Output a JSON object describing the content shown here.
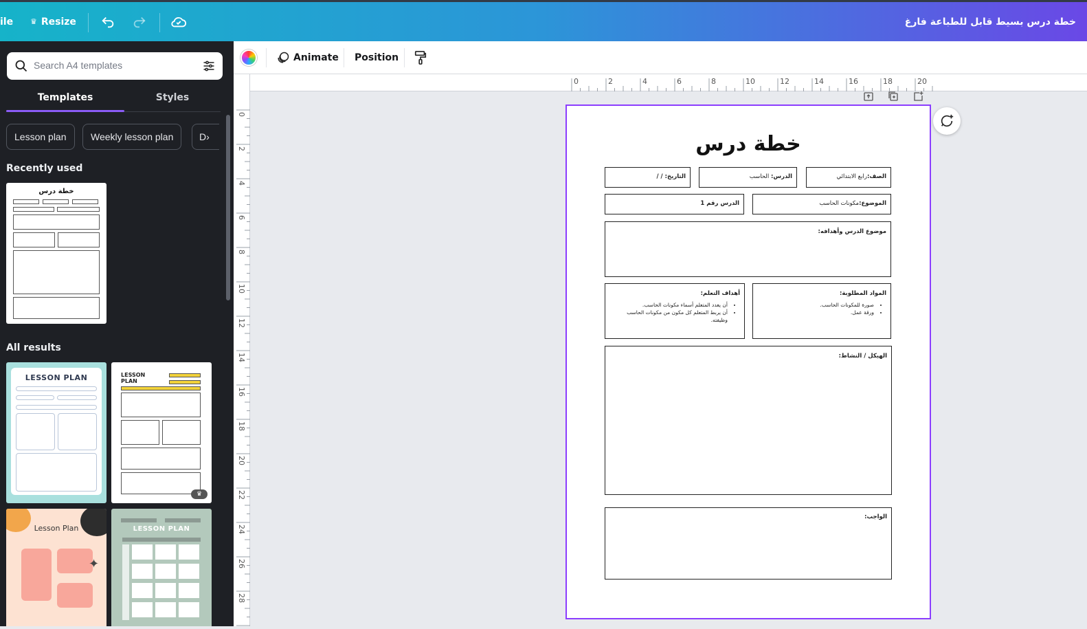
{
  "topbar": {
    "file_label": "ile",
    "resize_label": "Resize",
    "doc_title": "خطة درس بسيط قابل للطباعة فارغ"
  },
  "sidebar": {
    "search_placeholder": "Search A4 templates",
    "tabs": [
      {
        "label": "Templates"
      },
      {
        "label": "Styles"
      }
    ],
    "chips": [
      {
        "label": "Lesson plan"
      },
      {
        "label": "Weekly lesson plan"
      },
      {
        "label": "D"
      }
    ],
    "recently_used": "Recently used",
    "all_results": "All results",
    "results": [
      {
        "title": "LESSON PLAN"
      },
      {
        "title": "LESSON PLAN"
      },
      {
        "title": "Lesson Plan"
      },
      {
        "title": "LESSON PLAN"
      }
    ],
    "recent_thumb_title": "خطة درس"
  },
  "toolbar": {
    "animate_label": "Animate",
    "position_label": "Position"
  },
  "ruler": {
    "h_ticks": [
      "0",
      "2",
      "4",
      "6",
      "8",
      "10",
      "12",
      "14",
      "16",
      "18",
      "20"
    ],
    "v_ticks": [
      "0",
      "2",
      "4",
      "6",
      "8",
      "10",
      "12",
      "14",
      "16",
      "18",
      "20",
      "22",
      "24",
      "26",
      "28"
    ]
  },
  "document": {
    "title": "خطة درس",
    "grade_label": "الصف:",
    "grade_value": "رابع الابتدائي",
    "lesson_label": "الدرس:",
    "lesson_value": "الحاسب",
    "date_label": "التاريخ: /  /",
    "topic_label": "الموضوع:",
    "topic_value": "مكونات الحاسب",
    "lesson_no_label": "الدرس رقم 1",
    "objectives_label": "موضوع الدرس وأهدافه:",
    "materials_label": "المواد المطلوبة:",
    "materials": [
      "صورة للمكونات الحاسب.",
      "ورقة عمل."
    ],
    "outcomes_label": "أهداف التعلم:",
    "outcomes": [
      "أن يعدد المتعلم أسماء مكونات الحاسب.",
      "أن يربط المتعلم كل مكون من مكونات الحاسب وظيفته."
    ],
    "structure_label": "الهيكل / النشاط:",
    "homework_label": "الواجب:"
  },
  "colors": {
    "accent": "#8b3dff",
    "sidebar_bg": "#1e2025",
    "canvas_bg": "#e8eaee"
  }
}
